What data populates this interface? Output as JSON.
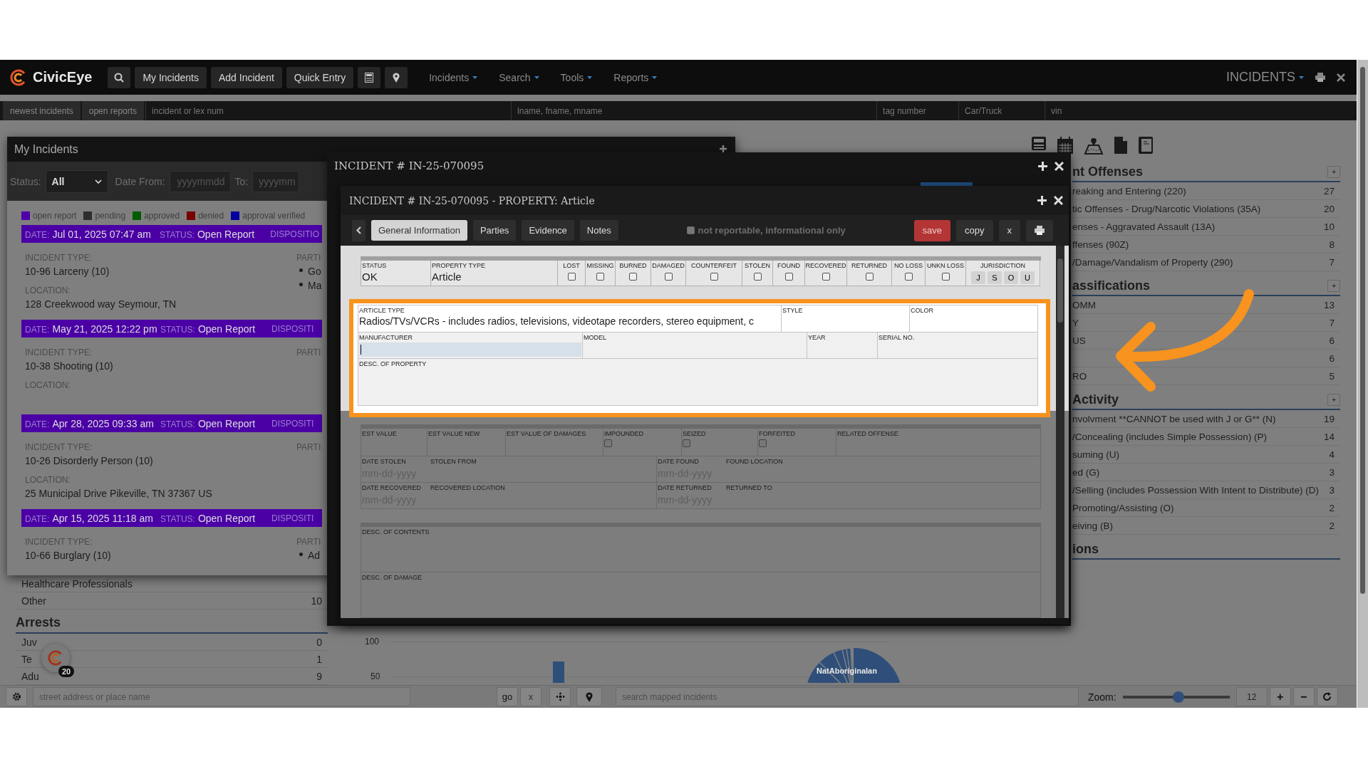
{
  "nav": {
    "logo": "CivicEye",
    "buttons": [
      "My Incidents",
      "Add Incident",
      "Quick Entry"
    ],
    "menus": [
      "Incidents",
      "Search",
      "Tools",
      "Reports"
    ],
    "module_menu": "INCIDENTS"
  },
  "quick_bar": {
    "buttons": [
      "newest incidents",
      "open reports"
    ],
    "fields": [
      {
        "placeholder": "incident or lex num"
      },
      {
        "placeholder": "lname, fname, mname"
      },
      {
        "placeholder": "tag number"
      },
      {
        "placeholder": "Car/Truck"
      },
      {
        "placeholder": "vin"
      }
    ]
  },
  "left_panel": {
    "rows": [
      {
        "label": "Healthcare Professionals"
      },
      {
        "label": "Other",
        "count": "10"
      }
    ],
    "arrests": {
      "title": "Arrests",
      "rows": [
        {
          "label": "Juv",
          "count": "0"
        },
        {
          "label": "Te",
          "count": "1"
        },
        {
          "label": "Adu",
          "count": "9"
        }
      ]
    }
  },
  "chart": {
    "yticks": [
      "100",
      "50"
    ],
    "pie_label": "NatAboriginalan"
  },
  "notification_badge": {
    "count": "20"
  },
  "right_panel": {
    "sections": [
      {
        "title": "nt Offenses",
        "plus": "+",
        "rows": [
          {
            "label": "reaking and Entering (220)",
            "count": "27"
          },
          {
            "label": "tic Offenses - Drug/Narcotic Violations (35A)",
            "count": "20"
          },
          {
            "label": "enses - Aggravated Assault (13A)",
            "count": "10"
          },
          {
            "label": "ffenses (90Z)",
            "count": "8"
          },
          {
            "label": "/Damage/Vandalism of Property (290)",
            "count": "7"
          }
        ]
      },
      {
        "title": "assifications",
        "plus": "+",
        "rows": [
          {
            "label": "OMM",
            "count": "13"
          },
          {
            "label": "Y",
            "count": "7"
          },
          {
            "label": "US",
            "count": "6"
          },
          {
            "count": "6"
          },
          {
            "label": "RO",
            "count": "5"
          }
        ]
      },
      {
        "title": "Activity",
        "plus": "+",
        "rows": [
          {
            "label": "nvolvment **CANNOT be used with J or G** (N)",
            "count": "19"
          },
          {
            "label": "/Concealing (includes Simple Possession) (P)",
            "count": "14"
          },
          {
            "label": "suming (U)",
            "count": "4"
          },
          {
            "label": "ed (G)",
            "count": "3"
          },
          {
            "label": "/Selling (includes Possession With Intent to Distribute) (D)",
            "count": "3"
          },
          {
            "label": "Promoting/Assisting (O)",
            "count": "2"
          },
          {
            "label": "eiving (B)",
            "count": "2"
          }
        ]
      },
      {
        "title": "ions"
      }
    ]
  },
  "map_bar": {
    "address": {
      "placeholder": "street address or place name"
    },
    "go": "go",
    "clear": "x",
    "search": {
      "placeholder": "search mapped incidents"
    },
    "zoom_label": "Zoom:",
    "zoom": {
      "level": 0.52
    },
    "zoom_value": "12",
    "zoom_in": "+",
    "zoom_out": "−"
  },
  "my_incidents": {
    "title": "My Incidents",
    "filters": {
      "status_label": "Status:",
      "status_value": "All",
      "date_from_label": "Date From:",
      "date_from": {
        "placeholder": "yyyymmdd"
      },
      "to_label": "To:",
      "to": {
        "placeholder": "yyyymm"
      }
    },
    "legend": [
      {
        "label": "open report",
        "color": "#4f00a8"
      },
      {
        "label": "pending",
        "color": "#2e2e2e"
      },
      {
        "label": "approved",
        "color": "#005c00"
      },
      {
        "label": "denied",
        "color": "#7a0000"
      },
      {
        "label": "approval verified",
        "color": "#0000a0"
      }
    ],
    "incidents": [
      {
        "date_label": "DATE:",
        "date": "Jul 01, 2025 07:47 am",
        "status_label": "STATUS:",
        "status": "Open Report",
        "disposition_label": "DISPOSITIO",
        "type_label": "INCIDENT TYPE:",
        "type": "10-96 Larceny (10)",
        "parties_label": "PARTI",
        "parties": [
          "Go",
          "Ma"
        ],
        "location_label": "LOCATION:",
        "location": "128 Creekwood way Seymour, TN"
      },
      {
        "date_label": "DATE:",
        "date": "May 21, 2025 12:22 pm",
        "status_label": "STATUS:",
        "status": "Open Report",
        "disposition_label": "DISPOSITI",
        "type_label": "INCIDENT TYPE:",
        "type": "10-38 Shooting (10)",
        "parties_label": "PARTI",
        "location_label": "LOCATION:"
      },
      {
        "date_label": "DATE:",
        "date": "Apr 28, 2025 09:33 am",
        "status_label": "STATUS:",
        "status": "Open Report",
        "disposition_label": "DISPOSITI",
        "type_label": "INCIDENT TYPE:",
        "type": "10-26 Disorderly Person (10)",
        "parties_label": "PARTI",
        "location_label": "LOCATION:",
        "location": "25 Municipal Drive Pikeville, TN 37367 US"
      },
      {
        "date_label": "DATE:",
        "date": "Apr 15, 2025 11:18 am",
        "status_label": "STATUS:",
        "status": "Open Report",
        "disposition_label": "DISPOSITI",
        "type_label": "INCIDENT TYPE:",
        "type": "10-66 Burglary (10)",
        "parties_label": "PARTI",
        "parties": [
          "Ad"
        ]
      }
    ]
  },
  "incident_window": {
    "title": "INCIDENT # IN-25-070095"
  },
  "property_window": {
    "title": "INCIDENT # IN-25-070095 - PROPERTY: Article",
    "tabs": [
      {
        "label": "General Information",
        "selected": true
      },
      {
        "label": "Parties",
        "selected": false
      },
      {
        "label": "Evidence",
        "selected": false
      },
      {
        "label": "Notes",
        "selected": false
      }
    ],
    "not_reportable": {
      "label": "not reportable, informational only",
      "checked": false
    },
    "actions": {
      "save": "save",
      "copy": "copy",
      "close": "x"
    },
    "status": {
      "label": "STATUS",
      "value": "OK"
    },
    "property_type": {
      "label": "PROPERTY TYPE",
      "value": "Article"
    },
    "flags": [
      {
        "label": "LOST",
        "checked": false
      },
      {
        "label": "MISSING",
        "checked": false
      },
      {
        "label": "BURNED",
        "checked": false
      },
      {
        "label": "DAMAGED",
        "checked": false
      },
      {
        "label": "COUNTERFEIT",
        "checked": false
      },
      {
        "label": "STOLEN",
        "checked": false
      },
      {
        "label": "FOUND",
        "checked": false
      },
      {
        "label": "RECOVERED",
        "checked": false
      },
      {
        "label": "RETURNED",
        "checked": false
      },
      {
        "label": "NO LOSS",
        "checked": false
      },
      {
        "label": "UNKN LOSS",
        "checked": false
      }
    ],
    "jurisdiction": {
      "label": "JURISDICTION",
      "options": [
        "J",
        "S",
        "O",
        "U"
      ]
    },
    "article_type": {
      "label": "ARTICLE TYPE",
      "value": "Radios/TVs/VCRs - includes radios, televisions, videotape recorders, stereo equipment, c"
    },
    "style": {
      "label": "STYLE"
    },
    "color": {
      "label": "COLOR"
    },
    "manufacturer": {
      "label": "MANUFACTURER",
      "focused": true
    },
    "model": {
      "label": "MODEL"
    },
    "year": {
      "label": "YEAR"
    },
    "serial_no": {
      "label": "SERIAL NO."
    },
    "description": {
      "label": "DESC. OF PROPERTY"
    },
    "values_row": [
      {
        "label": "EST VALUE",
        "kind": "text"
      },
      {
        "label": "EST VALUE NEW",
        "kind": "text"
      },
      {
        "label": "EST VALUE OF DAMAGES",
        "kind": "text"
      },
      {
        "label": "IMPOUNDED",
        "kind": "checkbox",
        "checked": false
      },
      {
        "label": "SEIZED",
        "kind": "checkbox",
        "checked": false
      },
      {
        "label": "FORFEITED",
        "kind": "checkbox",
        "checked": false
      },
      {
        "label": "RELATED OFFENSE",
        "kind": "text"
      }
    ],
    "dates": [
      {
        "date_label": "DATE STOLEN",
        "placeholder": "mm-dd-yyyy",
        "place_label": "STOLEN FROM"
      },
      {
        "date_label": "DATE FOUND",
        "placeholder": "mm-dd-yyyy",
        "place_label": "FOUND LOCATION"
      },
      {
        "date_label": "DATE RECOVERED",
        "placeholder": "mm-dd-yyyy",
        "place_label": "RECOVERED LOCATION"
      },
      {
        "date_label": "DATE RETURNED",
        "placeholder": "mm-dd-yyyy",
        "place_label": "RETURNED TO"
      }
    ],
    "descriptions": [
      {
        "label": "DESC. OF CONTENTS"
      },
      {
        "label": "DESC. OF DAMAGE"
      }
    ]
  }
}
